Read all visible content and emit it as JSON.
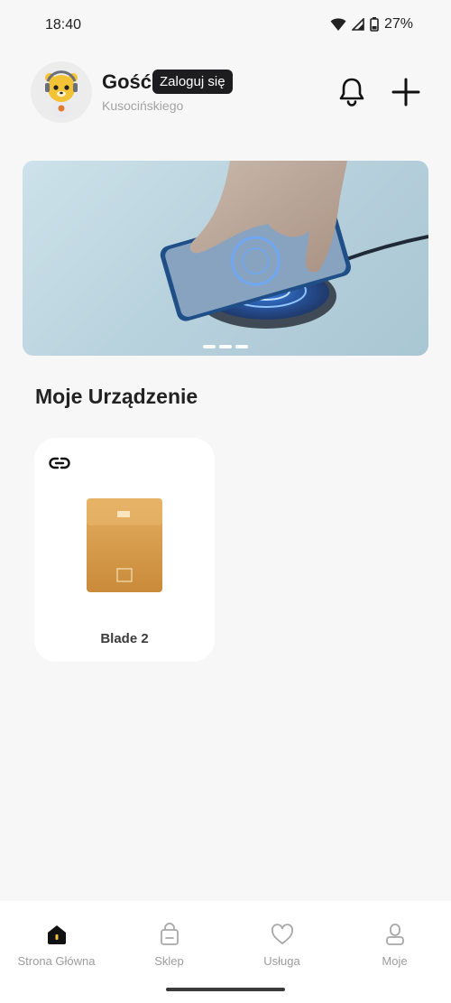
{
  "status_bar": {
    "time": "18:40",
    "battery": "27%",
    "icons": [
      "wifi-icon",
      "cellular-signal-icon",
      "battery-icon"
    ]
  },
  "header": {
    "user_name": "Gość",
    "login_label": "Zaloguj się",
    "location": "Kusocińskiego",
    "avatar_icon": "robot-bear-avatar",
    "actions": [
      "bell-icon",
      "plus-icon"
    ]
  },
  "banner": {
    "image": "wireless-charger-with-phone",
    "slide_count": 3
  },
  "devices_section": {
    "title": "Moje Urządzenie",
    "devices": [
      {
        "name": "Blade 2",
        "icon": "link-icon",
        "image": "power-bank"
      }
    ]
  },
  "bottom_nav": {
    "items": [
      {
        "label": "Strona Główna",
        "icon": "home-icon",
        "active": true
      },
      {
        "label": "Sklep",
        "icon": "shopping-bag-icon",
        "active": false
      },
      {
        "label": "Usługa",
        "icon": "heart-icon",
        "active": false
      },
      {
        "label": "Moje",
        "icon": "profile-icon",
        "active": false
      }
    ]
  },
  "colors": {
    "background": "#f7f7f7",
    "card": "#ffffff",
    "badge": "#1d1d1f",
    "nav_inactive": "#9c9c9c",
    "nav_active": "#1c1c1c",
    "device_gold": "#d9a24f"
  }
}
